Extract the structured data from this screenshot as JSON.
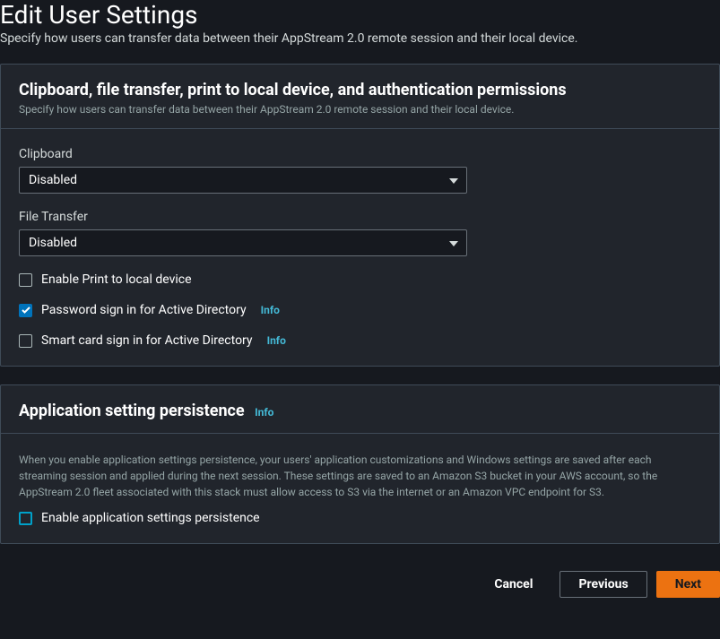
{
  "page": {
    "title": "Edit User Settings",
    "subtitle": "Specify how users can transfer data between their AppStream 2.0 remote session and their local device."
  },
  "section1": {
    "title": "Clipboard, file transfer, print to local device, and authentication permissions",
    "desc": "Specify how users can transfer data between their AppStream 2.0 remote session and their local device.",
    "clipboard": {
      "label": "Clipboard",
      "value": "Disabled"
    },
    "fileTransfer": {
      "label": "File Transfer",
      "value": "Disabled"
    },
    "printLocal": {
      "label": "Enable Print to local device"
    },
    "passwordSignIn": {
      "label": "Password sign in for Active Directory",
      "info": "Info"
    },
    "smartCardSignIn": {
      "label": "Smart card sign in for Active Directory",
      "info": "Info"
    }
  },
  "section2": {
    "title": "Application setting persistence",
    "info": "Info",
    "desc": "When you enable application settings persistence, your users' application customizations and Windows settings are saved after each streaming session and applied during the next session. These settings are saved to an Amazon S3 bucket in your AWS account, so the AppStream 2.0 fleet associated with this stack must allow access to S3 via the internet or an Amazon VPC endpoint for S3.",
    "enableLabel": "Enable application settings persistence"
  },
  "footer": {
    "cancel": "Cancel",
    "previous": "Previous",
    "next": "Next"
  }
}
